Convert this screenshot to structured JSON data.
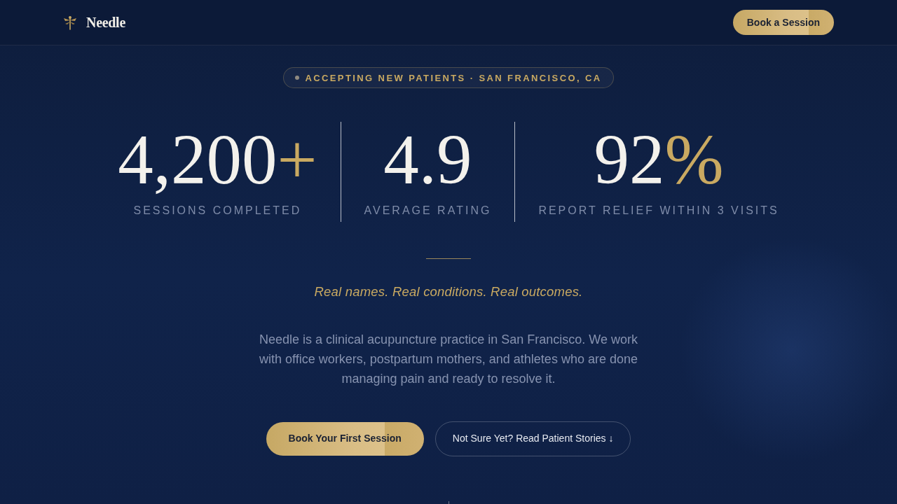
{
  "nav": {
    "brand": "Needle",
    "cta": "Book a Session"
  },
  "hero": {
    "badge": "ACCEPTING NEW PATIENTS · SAN FRANCISCO, CA",
    "stats": [
      {
        "value": "4,200",
        "suffix": "+",
        "label": "SESSIONS COMPLETED"
      },
      {
        "value": "4.9",
        "label": "AVERAGE RATING"
      },
      {
        "value": "92",
        "suffix": "%",
        "label": "REPORT RELIEF WITHIN 3 VISITS"
      }
    ],
    "tagline": "Real names. Real conditions. Real outcomes.",
    "description": "Needle is a clinical acupuncture practice in San Francisco. We work with office workers, postpartum mothers, and athletes who are done managing pain and ready to resolve it.",
    "buttons": [
      {
        "kind": "primary",
        "label": "Book Your First Session"
      },
      {
        "kind": "outline",
        "label": "Not Sure Yet? Read Patient Stories ↓"
      }
    ]
  }
}
